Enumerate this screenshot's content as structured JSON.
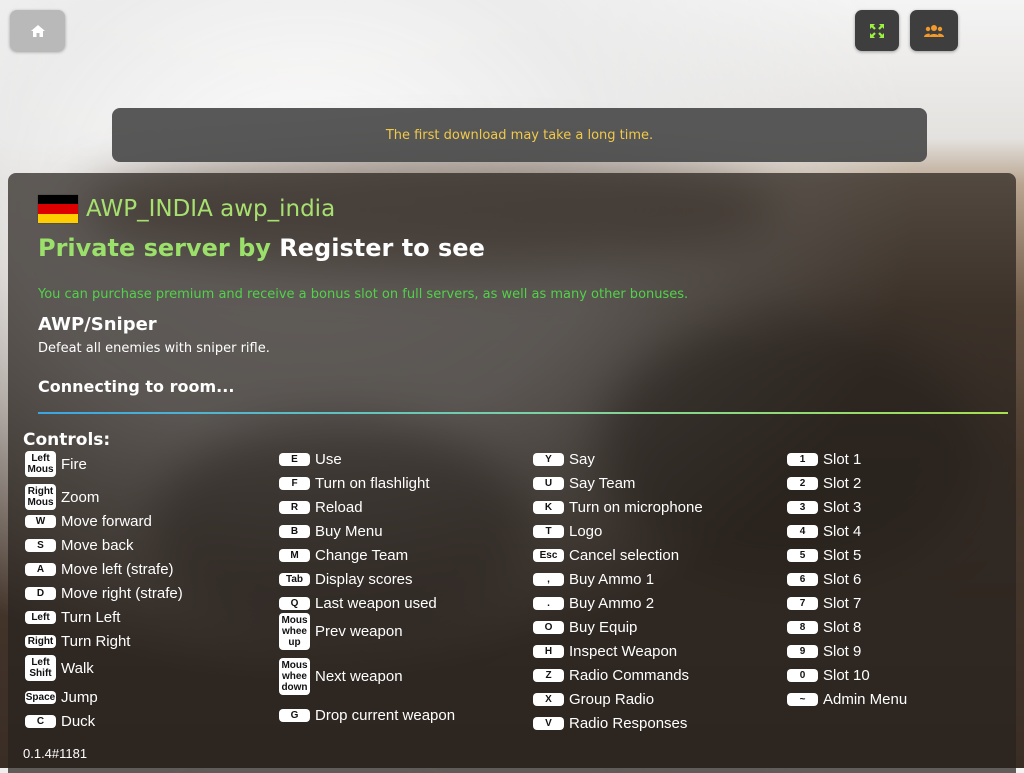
{
  "top_bar": {
    "home_icon": "home-icon",
    "fullscreen_icon": "fullscreen-icon",
    "users_icon": "users-icon"
  },
  "notice": {
    "text": "The first download may take a long time."
  },
  "server": {
    "flag_country": "Germany",
    "flag_colors": [
      "#000000",
      "#dd0000",
      "#ffce00"
    ],
    "name": "AWP_INDIA awp_india",
    "owner_prefix": "Private server by",
    "owner_name": "Register to see",
    "premium_text": "You can purchase premium and receive a bonus slot on full servers, as well as many other bonuses.",
    "mode_title": "AWP/Sniper",
    "mode_description": "Defeat all enemies with sniper rifle.",
    "status": "Connecting to room..."
  },
  "controls": {
    "title": "Controls:",
    "columns": [
      [
        {
          "key": "Left Mous",
          "label": "Fire"
        },
        {
          "key": "Right Mous",
          "label": "Zoom"
        },
        {
          "key": "W",
          "label": "Move forward"
        },
        {
          "key": "S",
          "label": "Move back"
        },
        {
          "key": "A",
          "label": "Move left (strafe)"
        },
        {
          "key": "D",
          "label": "Move right (strafe)"
        },
        {
          "key": "Left",
          "label": "Turn Left"
        },
        {
          "key": "Right",
          "label": "Turn Right"
        },
        {
          "key": "Left Shift",
          "label": "Walk"
        },
        {
          "key": "Space",
          "label": "Jump"
        },
        {
          "key": "C",
          "label": "Duck"
        }
      ],
      [
        {
          "key": "E",
          "label": "Use"
        },
        {
          "key": "F",
          "label": "Turn on flashlight"
        },
        {
          "key": "R",
          "label": "Reload"
        },
        {
          "key": "B",
          "label": "Buy Menu"
        },
        {
          "key": "M",
          "label": "Change Team"
        },
        {
          "key": "Tab",
          "label": "Display scores"
        },
        {
          "key": "Q",
          "label": "Last weapon used"
        },
        {
          "key": "Mous whee up",
          "label": "Prev weapon"
        },
        {
          "key": "Mous whee down",
          "label": "Next weapon"
        },
        {
          "key": "G",
          "label": "Drop current weapon"
        }
      ],
      [
        {
          "key": "Y",
          "label": "Say"
        },
        {
          "key": "U",
          "label": "Say Team"
        },
        {
          "key": "K",
          "label": "Turn on microphone"
        },
        {
          "key": "T",
          "label": "Logo"
        },
        {
          "key": "Esc",
          "label": "Cancel selection"
        },
        {
          "key": ",",
          "label": "Buy Ammo 1"
        },
        {
          "key": ".",
          "label": "Buy Ammo 2"
        },
        {
          "key": "O",
          "label": "Buy Equip"
        },
        {
          "key": "H",
          "label": "Inspect Weapon"
        },
        {
          "key": "Z",
          "label": "Radio Commands"
        },
        {
          "key": "X",
          "label": "Group Radio"
        },
        {
          "key": "V",
          "label": "Radio Responses"
        }
      ],
      [
        {
          "key": "1",
          "label": "Slot 1"
        },
        {
          "key": "2",
          "label": "Slot 2"
        },
        {
          "key": "3",
          "label": "Slot 3"
        },
        {
          "key": "4",
          "label": "Slot 4"
        },
        {
          "key": "5",
          "label": "Slot 5"
        },
        {
          "key": "6",
          "label": "Slot 6"
        },
        {
          "key": "7",
          "label": "Slot 7"
        },
        {
          "key": "8",
          "label": "Slot 8"
        },
        {
          "key": "9",
          "label": "Slot 9"
        },
        {
          "key": "0",
          "label": "Slot 10"
        },
        {
          "key": "~",
          "label": "Admin Menu"
        }
      ]
    ]
  },
  "version": "0.1.4#1181"
}
